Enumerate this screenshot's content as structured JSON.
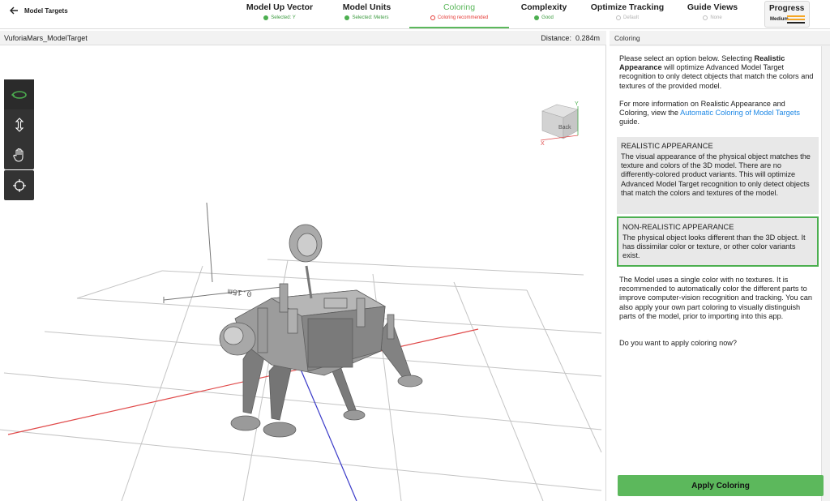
{
  "header": {
    "back_label": "Model Targets",
    "steps": [
      {
        "title": "Model Up Vector",
        "status": "Selected: Y"
      },
      {
        "title": "Model Units",
        "status": "Selected: Meters"
      },
      {
        "title": "Coloring",
        "status": "Coloring recommended"
      },
      {
        "title": "Complexity",
        "status": "Good"
      },
      {
        "title": "Optimize Tracking",
        "status": "Default"
      },
      {
        "title": "Guide Views",
        "status": "None"
      }
    ],
    "progress": {
      "title": "Progress",
      "level": "Medium"
    }
  },
  "viewport": {
    "model_name": "VuforiaMars_ModelTarget",
    "distance_label": "Distance:",
    "distance_value": "0.284m",
    "scale_label": "0.15m",
    "cube_face": "Back",
    "axis_x": "X",
    "axis_y": "Y"
  },
  "panel": {
    "title": "Coloring",
    "intro_1": "Please select an option below. Selecting ",
    "intro_bold": "Realistic Appearance",
    "intro_2": " will optimize Advanced Model Target recognition to only detect objects that match the colors and textures of the provided model.",
    "info_1": "For more information on Realistic Appearance and Coloring, view the ",
    "info_link": "Automatic Coloring of Model Targets",
    "info_2": " guide.",
    "options": [
      {
        "title": "REALISTIC APPEARANCE",
        "desc": "The visual appearance of the physical object matches the texture and colors of the 3D model. There are no differently-colored product variants. This will optimize Advanced Model Target recognition to only detect objects that match the colors and textures of the model."
      },
      {
        "title": "NON-REALISTIC APPEARANCE",
        "desc": "The physical object looks different than the 3D object. It has dissimilar color or texture, or other color variants exist."
      }
    ],
    "note": "The Model uses a single color with no textures. It is recommended to automatically color the different parts to improve computer-vision recognition and tracking. You can also apply your own part coloring to visually distinguish parts of the model, prior to importing into this app.",
    "question": "Do you want to apply coloring now?",
    "apply_label": "Apply Coloring"
  },
  "colors": {
    "accent_green": "#5cb85c",
    "status_green": "#4caf50",
    "warning_red": "#e53935",
    "link_blue": "#1e88e5",
    "progress_orange": "#f5a623"
  },
  "icons": {
    "back": "arrow-left-icon",
    "orbit": "orbit-icon",
    "move_vertical": "move-vertical-icon",
    "pan": "hand-icon",
    "recenter": "crosshair-icon",
    "progress_bars": "progress-bars-icon"
  }
}
